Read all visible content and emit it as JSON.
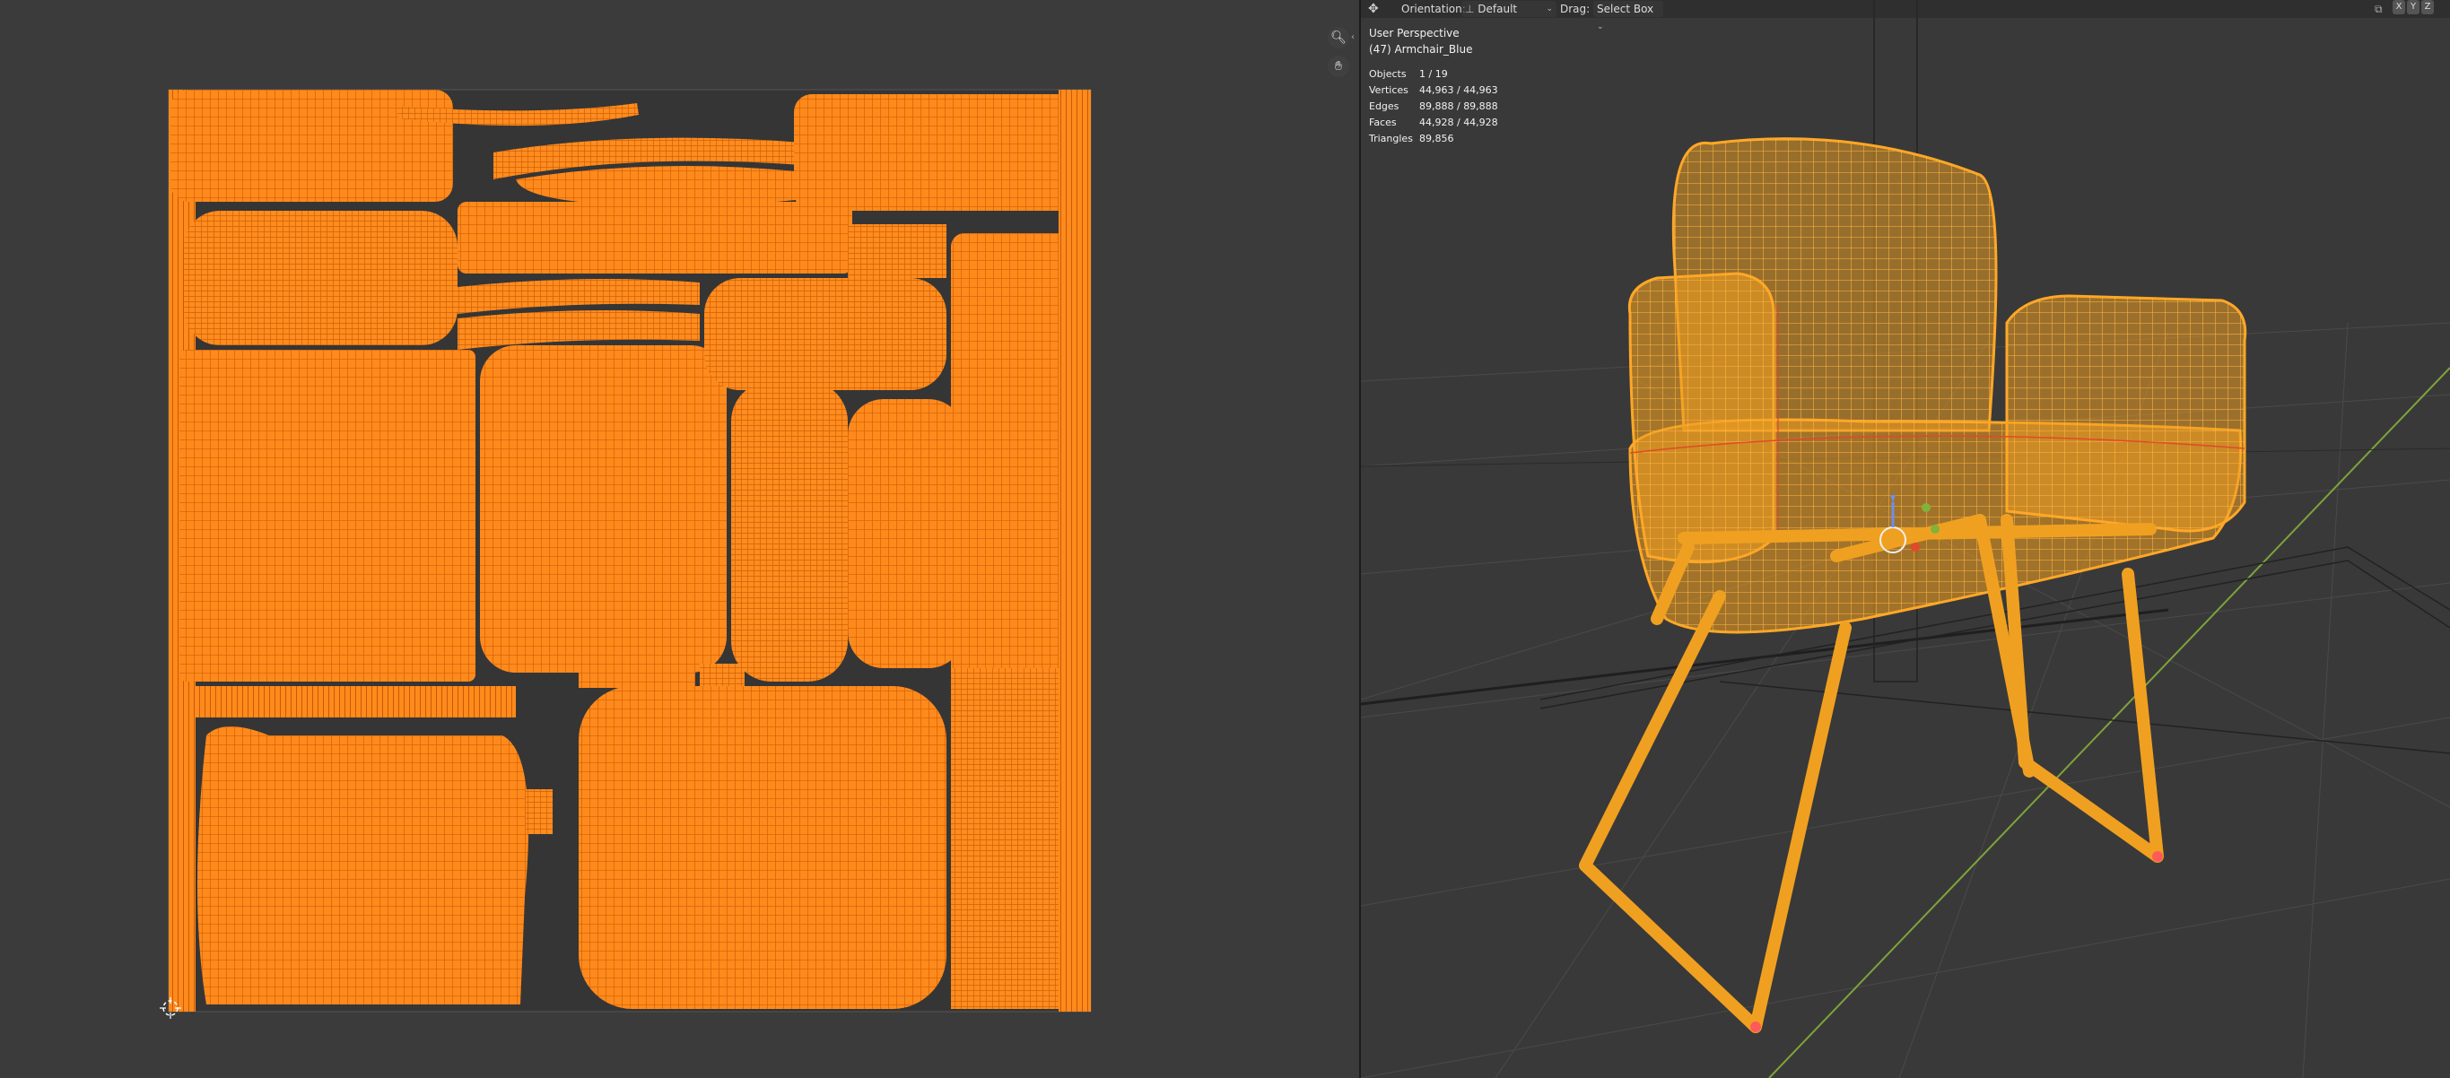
{
  "uv_editor": {
    "cursor_icon": "2d-cursor-icon"
  },
  "viewport_header": {
    "transform_icon": "transform-pivot-icon",
    "orientation_label": "Orientation:",
    "orientation_icon": "orientation-gizmo-icon",
    "orientation_value": "Default",
    "drag_label": "Drag:",
    "drag_value": "Select Box",
    "chevron": "⌄",
    "axis_x": "X",
    "axis_y": "Y",
    "axis_z": "Z"
  },
  "viewport_overlay": {
    "perspective": "User Perspective",
    "object_name": "(47) Armchair_Blue",
    "stats": [
      {
        "label": "Objects",
        "value": "1 / 19"
      },
      {
        "label": "Vertices",
        "value": "44,963 / 44,963"
      },
      {
        "label": "Edges",
        "value": "89,888 / 89,888"
      },
      {
        "label": "Faces",
        "value": "44,928 / 44,928"
      },
      {
        "label": "Triangles",
        "value": "89,856"
      }
    ]
  },
  "navigation": {
    "zoom_icon": "zoom-icon",
    "pan_icon": "hand-pan-icon"
  },
  "colors": {
    "uv_orange": "#ff8a1c",
    "wire_orange": "#ffa726",
    "background": "#3b3b3b",
    "grid": "#4a4a4a",
    "x_axis": "#c23a3a",
    "y_axis": "#7fa33a"
  }
}
